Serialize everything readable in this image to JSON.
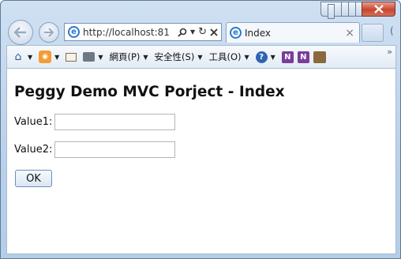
{
  "window": {
    "controls": {
      "minimize": "minimize",
      "maximize": "maximize",
      "close": "close"
    }
  },
  "nav": {
    "back_icon": "arrow-left-icon",
    "forward_icon": "arrow-right-icon"
  },
  "address": {
    "url": "http://localhost:81",
    "icons": [
      "search-icon",
      "dropdown-caret-icon",
      "refresh-icon",
      "stop-icon"
    ]
  },
  "tab": {
    "title": "Index",
    "close": "×"
  },
  "command_bar": {
    "items": [
      {
        "icon": "home-icon"
      },
      {
        "icon": "rss-feed-icon"
      },
      {
        "icon": "mail-icon"
      },
      {
        "icon": "print-icon"
      },
      {
        "label": "網頁(P)"
      },
      {
        "label": "安全性(S)"
      },
      {
        "label": "工具(O)"
      },
      {
        "icon": "help-icon"
      },
      {
        "icon": "onenote-icon"
      },
      {
        "icon": "onenote-linked-icon"
      },
      {
        "icon": "research-icon"
      }
    ],
    "more": "»"
  },
  "page": {
    "heading": "Peggy Demo MVC Porject - Index",
    "value1_label": "Value1:",
    "value1": "",
    "value2_label": "Value2:",
    "value2": "",
    "submit_label": "OK"
  }
}
